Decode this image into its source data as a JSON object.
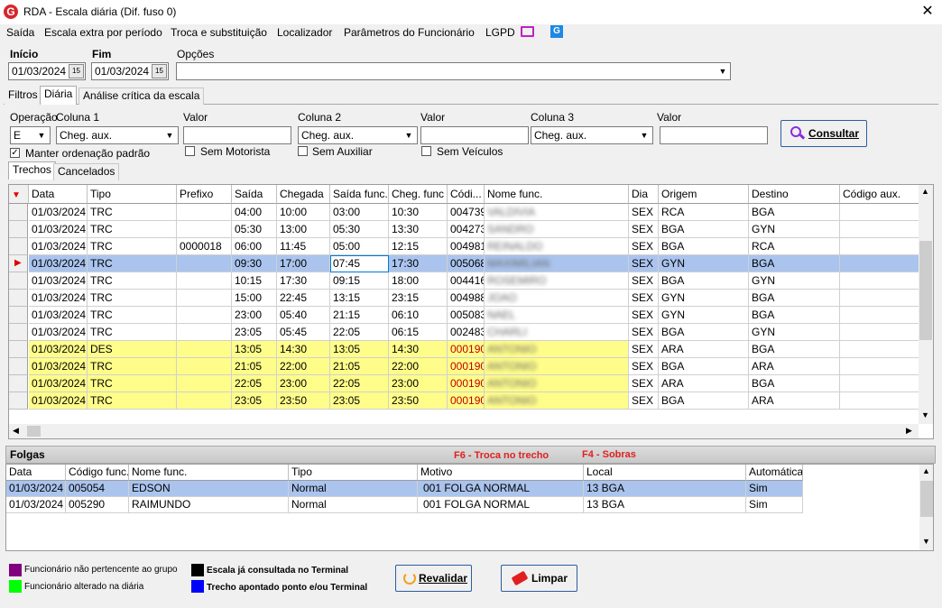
{
  "window": {
    "title": "RDA - Escala diária (Dif. fuso 0)",
    "close_glyph": "✕",
    "logo_glyph": "G"
  },
  "menu": [
    "Saída",
    "Escala extra por período",
    "Troca e substituição",
    "Localizador",
    "Parâmetros do Funcionário",
    "LGPD"
  ],
  "filters": {
    "inicio_label": "Início",
    "inicio_value": "01/03/2024",
    "fim_label": "Fim",
    "fim_value": "01/03/2024",
    "opcoes_label": "Opções",
    "opcoes_value": "",
    "cal_glyph": "15"
  },
  "main_tabs": [
    "Filtros",
    "Diária",
    "Análise crítica da escala"
  ],
  "query": {
    "operacao_label": "Operação",
    "operacao_value": "E",
    "coluna1_label": "Coluna 1",
    "coluna1_value": "Cheg. aux.",
    "valor1_label": "Valor",
    "valor1_value": "",
    "coluna2_label": "Coluna 2",
    "coluna2_value": "Cheg. aux.",
    "valor2_label": "Valor",
    "valor2_value": "",
    "coluna3_label": "Coluna 3",
    "coluna3_value": "Cheg. aux.",
    "valor3_label": "Valor",
    "valor3_value": "",
    "consultar_label": "Consultar",
    "manter_label": "Manter ordenação padrão",
    "manter_checked": true,
    "sem_motorista_label": "Sem Motorista",
    "sem_auxiliar_label": "Sem Auxiliar",
    "sem_veiculos_label": "Sem Veículos"
  },
  "sub_tabs": [
    "Trechos",
    "Cancelados"
  ],
  "trechos": {
    "columns": [
      "Data",
      "Tipo",
      "Prefixo",
      "Saída",
      "Chegada",
      "Saída func.",
      "Cheg. func",
      "Códi...",
      "Nome func.",
      "Dia",
      "Origem",
      "Destino",
      "Código aux."
    ],
    "rows": [
      {
        "data": "01/03/2024",
        "tipo": "TRC",
        "prefixo": "",
        "saida": "04:00",
        "chegada": "10:00",
        "saida_func": "03:00",
        "cheg_func": "10:30",
        "codigo": "004739",
        "nome": "VALDIVIA",
        "dia": "SEX",
        "origem": "RCA",
        "destino": "BGA",
        "aux": "",
        "style": "normal"
      },
      {
        "data": "01/03/2024",
        "tipo": "TRC",
        "prefixo": "",
        "saida": "05:30",
        "chegada": "13:00",
        "saida_func": "05:30",
        "cheg_func": "13:30",
        "codigo": "004273",
        "nome": "SANDRO",
        "dia": "SEX",
        "origem": "BGA",
        "destino": "GYN",
        "aux": "",
        "style": "normal"
      },
      {
        "data": "01/03/2024",
        "tipo": "TRC",
        "prefixo": "0000018",
        "saida": "06:00",
        "chegada": "11:45",
        "saida_func": "05:00",
        "cheg_func": "12:15",
        "codigo": "004981",
        "nome": "REINALDO",
        "dia": "SEX",
        "origem": "BGA",
        "destino": "RCA",
        "aux": "",
        "style": "normal"
      },
      {
        "data": "01/03/2024",
        "tipo": "TRC",
        "prefixo": "",
        "saida": "09:30",
        "chegada": "17:00",
        "saida_func": "07:45",
        "cheg_func": "17:30",
        "codigo": "005068",
        "nome": "MAXIMILIAN",
        "dia": "SEX",
        "origem": "GYN",
        "destino": "BGA",
        "aux": "",
        "style": "selected"
      },
      {
        "data": "01/03/2024",
        "tipo": "TRC",
        "prefixo": "",
        "saida": "10:15",
        "chegada": "17:30",
        "saida_func": "09:15",
        "cheg_func": "18:00",
        "codigo": "004416",
        "nome": "ROSEMIRO",
        "dia": "SEX",
        "origem": "BGA",
        "destino": "GYN",
        "aux": "",
        "style": "normal"
      },
      {
        "data": "01/03/2024",
        "tipo": "TRC",
        "prefixo": "",
        "saida": "15:00",
        "chegada": "22:45",
        "saida_func": "13:15",
        "cheg_func": "23:15",
        "codigo": "004988",
        "nome": "JOAO",
        "dia": "SEX",
        "origem": "GYN",
        "destino": "BGA",
        "aux": "",
        "style": "normal"
      },
      {
        "data": "01/03/2024",
        "tipo": "TRC",
        "prefixo": "",
        "saida": "23:00",
        "chegada": "05:40",
        "saida_func": "21:15",
        "cheg_func": "06:10",
        "codigo": "005083",
        "nome": "NAEL",
        "dia": "SEX",
        "origem": "GYN",
        "destino": "BGA",
        "aux": "",
        "style": "normal"
      },
      {
        "data": "01/03/2024",
        "tipo": "TRC",
        "prefixo": "",
        "saida": "23:05",
        "chegada": "05:45",
        "saida_func": "22:05",
        "cheg_func": "06:15",
        "codigo": "002483",
        "nome": "CHARLI",
        "dia": "SEX",
        "origem": "BGA",
        "destino": "GYN",
        "aux": "",
        "style": "normal"
      },
      {
        "data": "01/03/2024",
        "tipo": "DES",
        "prefixo": "",
        "saida": "13:05",
        "chegada": "14:30",
        "saida_func": "13:05",
        "cheg_func": "14:30",
        "codigo": "000190",
        "nome": "ANTONIO",
        "dia": "SEX",
        "origem": "ARA",
        "destino": "BGA",
        "aux": "",
        "style": "yellow"
      },
      {
        "data": "01/03/2024",
        "tipo": "TRC",
        "prefixo": "",
        "saida": "21:05",
        "chegada": "22:00",
        "saida_func": "21:05",
        "cheg_func": "22:00",
        "codigo": "000190",
        "nome": "ANTONIO",
        "dia": "SEX",
        "origem": "BGA",
        "destino": "ARA",
        "aux": "",
        "style": "yellow"
      },
      {
        "data": "01/03/2024",
        "tipo": "TRC",
        "prefixo": "",
        "saida": "22:05",
        "chegada": "23:00",
        "saida_func": "22:05",
        "cheg_func": "23:00",
        "codigo": "000190",
        "nome": "ANTONIO",
        "dia": "SEX",
        "origem": "ARA",
        "destino": "BGA",
        "aux": "",
        "style": "yellow"
      },
      {
        "data": "01/03/2024",
        "tipo": "TRC",
        "prefixo": "",
        "saida": "23:05",
        "chegada": "23:50",
        "saida_func": "23:05",
        "cheg_func": "23:50",
        "codigo": "000190",
        "nome": "ANTONIO",
        "dia": "SEX",
        "origem": "BGA",
        "destino": "ARA",
        "aux": "",
        "style": "yellow"
      }
    ]
  },
  "folgas": {
    "title": "Folgas",
    "hint_f6": "F6 - Troca no trecho",
    "hint_f4": "F4 - Sobras",
    "columns": [
      "Data",
      "Código func.",
      "Nome func.",
      "Tipo",
      "Motivo",
      "Local",
      "Automática"
    ],
    "rows": [
      {
        "data": "01/03/2024",
        "codigo": "005054",
        "nome": "EDSON",
        "tipo": "Normal",
        "motivo": "001 FOLGA NORMAL",
        "local": "13 BGA",
        "auto": "Sim",
        "selected": true
      },
      {
        "data": "01/03/2024",
        "codigo": "005290",
        "nome": "RAIMUNDO",
        "tipo": "Normal",
        "motivo": "001 FOLGA NORMAL",
        "local": "13 BGA",
        "auto": "Sim",
        "selected": false
      }
    ]
  },
  "legend": [
    {
      "label": "Funcionário não pertencente ao grupo",
      "color": "#800080"
    },
    {
      "label": "Funcionário alterado na diária",
      "color": "#00ff00"
    },
    {
      "label": "Escala já consultada no Terminal",
      "color": "#000000"
    },
    {
      "label": "Trecho apontado ponto e/ou Terminal",
      "color": "#0000ff"
    }
  ],
  "buttons": {
    "revalidar": "Revalidar",
    "limpar": "Limpar"
  },
  "colors": {
    "selection": "#aac4ee",
    "yellow": "#fffd8a",
    "code_red": "#c00000",
    "accent_blue": "#2b5d9f",
    "tv_icon": "#c021c0",
    "g_icon": "#1e88e5"
  }
}
